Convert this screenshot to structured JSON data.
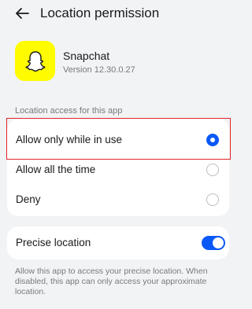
{
  "header": {
    "title": "Location permission",
    "back_icon": "arrow-left-icon"
  },
  "app": {
    "name": "Snapchat",
    "version": "Version 12.30.0.27",
    "icon": "snapchat-ghost-icon",
    "icon_color": "#fffc00"
  },
  "access": {
    "section_label": "Location access for this app",
    "options": [
      {
        "label": "Allow only while in use",
        "selected": true
      },
      {
        "label": "Allow all the time",
        "selected": false
      },
      {
        "label": "Deny",
        "selected": false
      }
    ]
  },
  "precise": {
    "label": "Precise location",
    "enabled": true,
    "description": "Allow this app to access your precise location. When disabled, this app can only access your approximate location."
  },
  "colors": {
    "accent": "#0a59f7",
    "highlight": "#e0242b",
    "background": "#f1f3f5"
  }
}
